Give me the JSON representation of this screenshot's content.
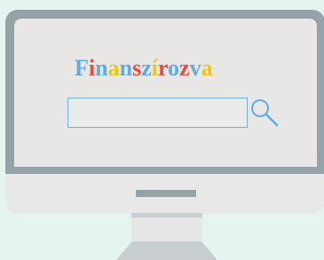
{
  "logo": {
    "letters": [
      {
        "char": "F",
        "color": "#5dade2"
      },
      {
        "char": "i",
        "color": "#e74c3c"
      },
      {
        "char": "n",
        "color": "#5dade2"
      },
      {
        "char": "a",
        "color": "#f1c40f"
      },
      {
        "char": "n",
        "color": "#5dade2"
      },
      {
        "char": "s",
        "color": "#e74c3c"
      },
      {
        "char": "z",
        "color": "#5dade2"
      },
      {
        "char": "í",
        "color": "#f1c40f"
      },
      {
        "char": "r",
        "color": "#e74c3c"
      },
      {
        "char": "o",
        "color": "#5dade2"
      },
      {
        "char": "z",
        "color": "#e74c3c"
      },
      {
        "char": "v",
        "color": "#5dade2"
      },
      {
        "char": "a",
        "color": "#f1c40f"
      }
    ]
  },
  "search": {
    "value": "",
    "icon": "magnifier"
  },
  "colors": {
    "background": "#e6f4ef",
    "frame": "#95a3a8",
    "screen": "#e9e7e6",
    "accent": "#5dade2"
  }
}
